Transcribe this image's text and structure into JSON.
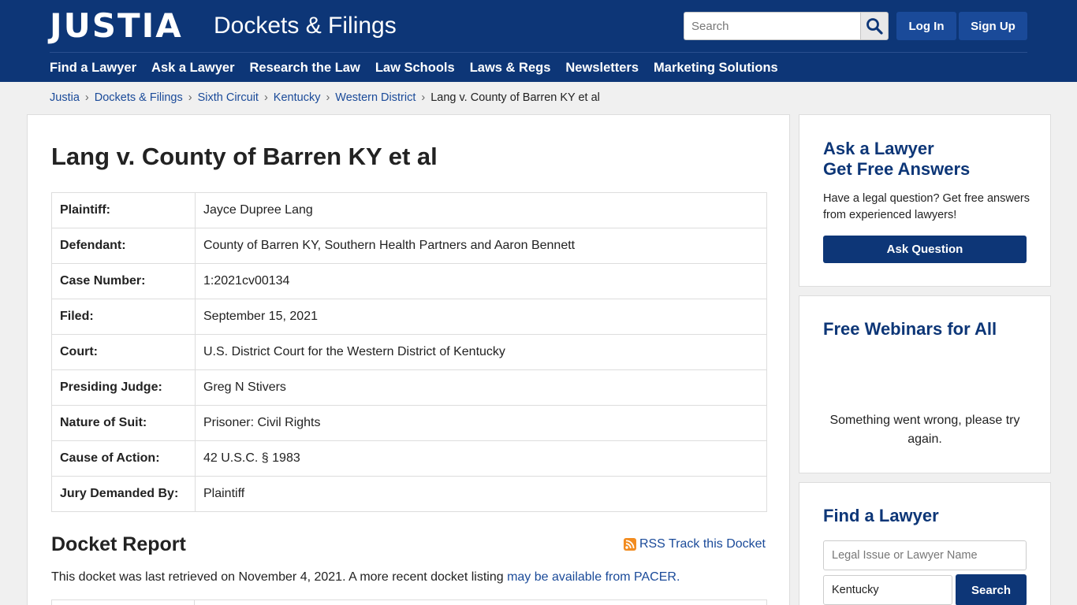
{
  "header": {
    "logo": "JUSTIA",
    "site_name": "Dockets & Filings",
    "search_placeholder": "Search",
    "login_label": "Log In",
    "signup_label": "Sign Up",
    "nav": [
      "Find a Lawyer",
      "Ask a Lawyer",
      "Research the Law",
      "Law Schools",
      "Laws & Regs",
      "Newsletters",
      "Marketing Solutions"
    ]
  },
  "breadcrumb": {
    "links": [
      "Justia",
      "Dockets & Filings",
      "Sixth Circuit",
      "Kentucky",
      "Western District"
    ],
    "separator": "›",
    "current": "Lang v. County of Barren KY et al"
  },
  "case": {
    "title": "Lang v. County of Barren KY et al",
    "rows": [
      {
        "label": "Plaintiff:",
        "value": "Jayce Dupree Lang"
      },
      {
        "label": "Defendant:",
        "value": "County of Barren KY, Southern Health Partners and Aaron Bennett"
      },
      {
        "label": "Case Number:",
        "value": "1:2021cv00134"
      },
      {
        "label": "Filed:",
        "value": "September 15, 2021"
      },
      {
        "label": "Court:",
        "value": "U.S. District Court for the Western District of Kentucky"
      },
      {
        "label": "Presiding Judge:",
        "value": "Greg N Stivers"
      },
      {
        "label": "Nature of Suit:",
        "value": "Prisoner: Civil Rights"
      },
      {
        "label": "Cause of Action:",
        "value": "42 U.S.C. § 1983"
      },
      {
        "label": "Jury Demanded By:",
        "value": "Plaintiff"
      }
    ]
  },
  "docket": {
    "title": "Docket Report",
    "rss_label": "RSS Track this Docket",
    "note_text": "This docket was last retrieved on November 4, 2021. A more recent docket listing ",
    "note_link": "may be available from PACER."
  },
  "sidebar": {
    "ask": {
      "title_line1": "Ask a Lawyer",
      "title_line2": "Get Free Answers",
      "text": "Have a legal question? Get free answers from experienced lawyers!",
      "button": "Ask Question"
    },
    "webinars": {
      "title": "Free Webinars for All",
      "error": "Something went wrong, please try again."
    },
    "find": {
      "title": "Find a Lawyer",
      "issue_placeholder": "Legal Issue or Lawyer Name",
      "location_value": "Kentucky",
      "button": "Search"
    }
  },
  "colors": {
    "header_bg": "#0d3677",
    "button_bg": "#1a4a99",
    "link": "#1a4a99",
    "page_bg": "#f0f0f0",
    "rss": "#f28c20"
  },
  "icons": [
    "search-icon",
    "rss-icon"
  ]
}
